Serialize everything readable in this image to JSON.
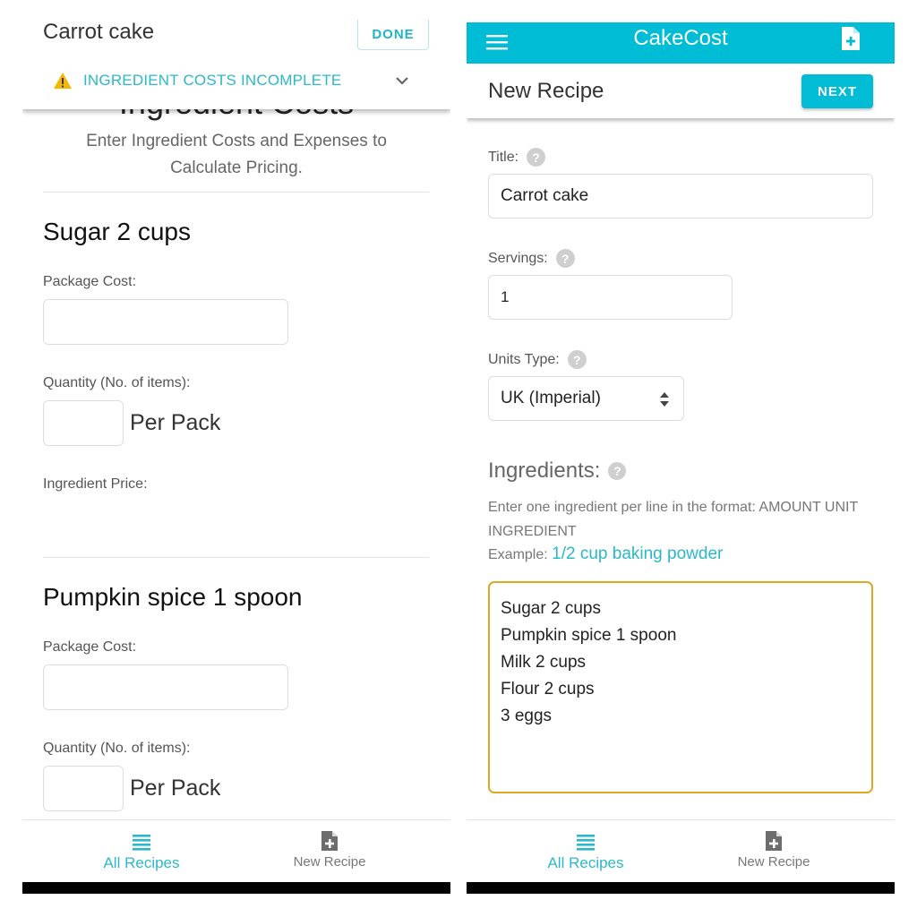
{
  "left_screen": {
    "header": {
      "recipe_title": "Carrot cake",
      "done_label": "DONE",
      "warning_text": "INGREDIENT COSTS INCOMPLETE"
    },
    "section_title": "Ingredient Costs",
    "section_subtitle": "Enter Ingredient Costs and Expenses to Calculate Pricing.",
    "ingredients": [
      {
        "heading": "Sugar 2 cups",
        "package_cost_label": "Package Cost:",
        "package_cost_value": "",
        "quantity_label": "Quantity (No. of items):",
        "quantity_value": "",
        "per_pack_label": "Per Pack",
        "price_label": "Ingredient Price:"
      },
      {
        "heading": "Pumpkin spice 1 spoon",
        "package_cost_label": "Package Cost:",
        "package_cost_value": "",
        "quantity_label": "Quantity (No. of items):",
        "quantity_value": "",
        "per_pack_label": "Per Pack"
      }
    ],
    "bottom_nav": [
      {
        "label": "All Recipes",
        "icon": "list-icon",
        "active": true
      },
      {
        "label": "New Recipe",
        "icon": "add-document-icon",
        "active": false
      }
    ]
  },
  "right_screen": {
    "app_bar": {
      "title": "CakeCost",
      "menu_icon": "hamburger-menu-icon",
      "action_icon": "add-document-icon"
    },
    "page_title": "New Recipe",
    "next_label": "NEXT",
    "form": {
      "title_label": "Title:",
      "title_value": "Carrot cake",
      "servings_label": "Servings:",
      "servings_value": "1",
      "units_label": "Units Type:",
      "units_value": "UK (Imperial)",
      "ingredients_label": "Ingredients:",
      "ingredients_help": "Enter one ingredient per line in the format: AMOUNT UNIT INGREDIENT",
      "example_prefix": "Example:",
      "example_value": "1/2 cup baking powder",
      "ingredients_lines": [
        "Sugar 2 cups",
        "Pumpkin spice 1 spoon",
        "Milk 2 cups",
        "Flour 2 cups",
        "3 eggs"
      ]
    },
    "bottom_nav": [
      {
        "label": "All Recipes",
        "icon": "list-icon",
        "active": true
      },
      {
        "label": "New Recipe",
        "icon": "add-document-icon",
        "active": false
      }
    ]
  },
  "colors": {
    "accent": "#00bcd4",
    "accent_text": "#2bb8c8",
    "warning": "#f5b800",
    "focus_border": "#e0a624"
  }
}
